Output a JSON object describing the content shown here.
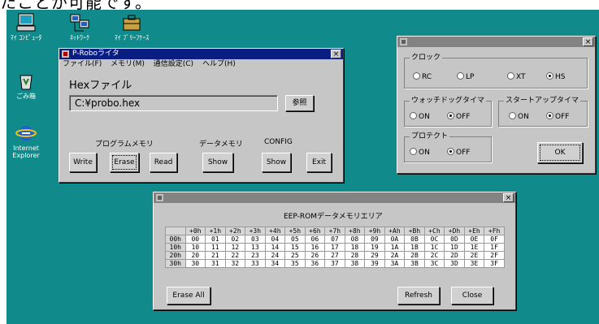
{
  "caption": "たことが可能です。",
  "desktop_icons": [
    {
      "label": "ﾏｲ ｺﾝﾋﾟｭｰﾀ"
    },
    {
      "label": "ﾈｯﾄﾜｰｸ"
    },
    {
      "label": "ﾏｲ ﾌﾞﾘｰﾌｹｰｽ"
    },
    {
      "label": "ごみ箱"
    },
    {
      "label": "Internet Explorer"
    }
  ],
  "writer": {
    "title": "P-Roboライタ",
    "menu": [
      "ファイル(F)",
      "メモリ(M)",
      "通信設定(C)",
      "ヘルプ(H)"
    ],
    "hex_label": "Hexファイル",
    "file_path": "C:¥probo.hex",
    "browse": "参照",
    "program_memory": "プログラムメモリ",
    "data_memory": "データメモリ",
    "config": "CONFIG",
    "write": "Write",
    "erase": "Erase",
    "read": "Read",
    "data_show": "Show",
    "config_show": "Show",
    "exit": "Exit"
  },
  "config_win": {
    "title": "",
    "clock_label": "クロック",
    "clock_options": [
      "RC",
      "LP",
      "XT",
      "HS"
    ],
    "clock_selected": "HS",
    "watchdog_label": "ウォッチドッグタイマ",
    "watchdog_on": "ON",
    "watchdog_off": "OFF",
    "startup_label": "スタートアップタイマ",
    "startup_on": "ON",
    "startup_off": "OFF",
    "protect_label": "プロテクト",
    "protect_on": "ON",
    "protect_off": "OFF",
    "ok": "OK"
  },
  "eep": {
    "title": "",
    "heading": "EEP-ROMデータメモリエリア",
    "columns": [
      "+0h",
      "+1h",
      "+2h",
      "+3h",
      "+4h",
      "+5h",
      "+6h",
      "+7h",
      "+8h",
      "+9h",
      "+Ah",
      "+Bh",
      "+Ch",
      "+Dh",
      "+Eh",
      "+Fh"
    ],
    "rows": [
      {
        "addr": "00h",
        "cells": [
          "00",
          "01",
          "02",
          "03",
          "04",
          "05",
          "06",
          "07",
          "08",
          "09",
          "0A",
          "0B",
          "0C",
          "0D",
          "0E",
          "0F"
        ]
      },
      {
        "addr": "10h",
        "cells": [
          "10",
          "11",
          "12",
          "13",
          "14",
          "15",
          "16",
          "17",
          "18",
          "19",
          "1A",
          "1B",
          "1C",
          "1D",
          "1E",
          "1F"
        ]
      },
      {
        "addr": "20h",
        "cells": [
          "20",
          "21",
          "22",
          "23",
          "24",
          "25",
          "26",
          "27",
          "28",
          "29",
          "2A",
          "2B",
          "2C",
          "2D",
          "2E",
          "2F"
        ]
      },
      {
        "addr": "30h",
        "cells": [
          "30",
          "31",
          "32",
          "33",
          "34",
          "35",
          "36",
          "37",
          "38",
          "39",
          "3A",
          "3B",
          "3C",
          "3D",
          "3E",
          "3F"
        ]
      }
    ],
    "erase_all": "Erase All",
    "refresh": "Refresh",
    "close": "Close"
  }
}
